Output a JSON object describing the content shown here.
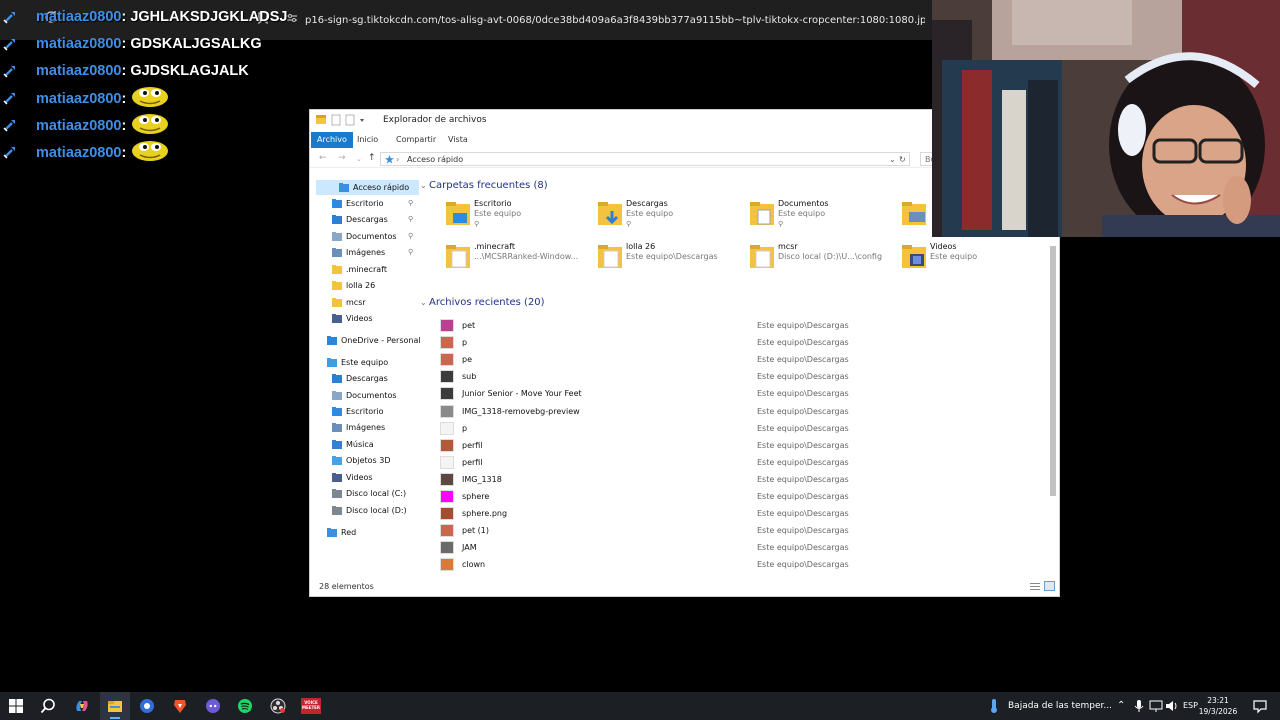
{
  "browser": {
    "url": "p16-sign-sg.tiktokcdn.com/tos-alisg-avt-0068/0dce38bd409a6a3f8439bb377a9115bb~tplv-tiktokx-cropcenter:1080:1080.jpeg?dr=14579&refresh_to..."
  },
  "chat": {
    "messages": [
      {
        "user": "matiaaz0800",
        "text": "JGHLAKSDJGKLADSJ",
        "emote": false
      },
      {
        "user": "matiaaz0800",
        "text": "GDSKALJGSALKG",
        "emote": false
      },
      {
        "user": "matiaaz0800",
        "text": "GJDSKLAGJALK",
        "emote": false
      },
      {
        "user": "matiaaz0800",
        "text": "",
        "emote": true
      },
      {
        "user": "matiaaz0800",
        "text": "",
        "emote": true
      },
      {
        "user": "matiaaz0800",
        "text": "",
        "emote": true
      }
    ],
    "colon": ":",
    "colors": {
      "username": "#3f8ee8",
      "text": "#ffffff"
    }
  },
  "explorer": {
    "title": "Explorador de archivos",
    "ribbon_tabs": [
      "Archivo",
      "Inicio",
      "Compartir",
      "Vista"
    ],
    "address_path": "Acceso rápido",
    "search_placeholder": "Bu",
    "nav_items": [
      {
        "label": "Acceso rápido",
        "icon": "star-icon",
        "pinned": false
      },
      {
        "label": "Escritorio",
        "icon": "desktop-folder-icon",
        "pinned": true
      },
      {
        "label": "Descargas",
        "icon": "download-folder-icon",
        "pinned": true
      },
      {
        "label": "Documentos",
        "icon": "documents-folder-icon",
        "pinned": true
      },
      {
        "label": "Imágenes",
        "icon": "pictures-folder-icon",
        "pinned": true
      },
      {
        "label": ".minecraft",
        "icon": "folder-icon",
        "pinned": false
      },
      {
        "label": "lolla 26",
        "icon": "folder-icon",
        "pinned": false
      },
      {
        "label": "mcsr",
        "icon": "folder-icon",
        "pinned": false
      },
      {
        "label": "Videos",
        "icon": "videos-folder-icon",
        "pinned": false
      },
      {
        "label": "OneDrive - Personal",
        "icon": "cloud-icon",
        "pinned": false
      },
      {
        "label": "Este equipo",
        "icon": "computer-icon",
        "pinned": false
      },
      {
        "label": "Descargas",
        "icon": "download-folder-icon",
        "pinned": false
      },
      {
        "label": "Documentos",
        "icon": "documents-folder-icon",
        "pinned": false
      },
      {
        "label": "Escritorio",
        "icon": "desktop-folder-icon",
        "pinned": false
      },
      {
        "label": "Imágenes",
        "icon": "pictures-folder-icon",
        "pinned": false
      },
      {
        "label": "Música",
        "icon": "music-icon",
        "pinned": false
      },
      {
        "label": "Objetos 3D",
        "icon": "cube-icon",
        "pinned": false
      },
      {
        "label": "Videos",
        "icon": "videos-folder-icon",
        "pinned": false
      },
      {
        "label": "Disco local (C:)",
        "icon": "drive-icon",
        "pinned": false
      },
      {
        "label": "Disco local (D:)",
        "icon": "drive-icon",
        "pinned": false
      },
      {
        "label": "Red",
        "icon": "network-icon",
        "pinned": false
      }
    ],
    "frequent_header": "Carpetas frecuentes (8)",
    "frequent_folders": [
      {
        "name": "Escritorio",
        "sub": "Este equipo",
        "pinned": true,
        "icon": "desktop-folder-icon"
      },
      {
        "name": "Descargas",
        "sub": "Este equipo",
        "pinned": true,
        "icon": "download-folder-icon"
      },
      {
        "name": "Documentos",
        "sub": "Este equipo",
        "pinned": true,
        "icon": "documents-folder-icon"
      },
      {
        "name": "",
        "sub": "",
        "pinned": false,
        "icon": "pictures-folder-icon"
      },
      {
        "name": ".minecraft",
        "sub": "...\\MCSRRanked-Window...",
        "pinned": false,
        "icon": "folder-icon"
      },
      {
        "name": "lolla 26",
        "sub": "Este equipo\\Descargas",
        "pinned": false,
        "icon": "folder-icon"
      },
      {
        "name": "mcsr",
        "sub": "Disco local (D:)\\U...\\config",
        "pinned": false,
        "icon": "folder-icon"
      },
      {
        "name": "Videos",
        "sub": "Este equipo",
        "pinned": false,
        "icon": "videos-folder-icon"
      }
    ],
    "recent_header": "Archivos recientes (20)",
    "recent_files": [
      {
        "name": "pet",
        "location": "Este equipo\\Descargas",
        "thumb": "#b8428f"
      },
      {
        "name": "p",
        "location": "Este equipo\\Descargas",
        "thumb": "#c9684f"
      },
      {
        "name": "pe",
        "location": "Este equipo\\Descargas",
        "thumb": "#c9684f"
      },
      {
        "name": "sub",
        "location": "Este equipo\\Descargas",
        "thumb": "#3b3b3b"
      },
      {
        "name": "Junior Senior - Move Your Feet",
        "location": "Este equipo\\Descargas",
        "thumb": "#3b3b3b"
      },
      {
        "name": "IMG_1318-removebg-preview",
        "location": "Este equipo\\Descargas",
        "thumb": "#8a8a8a"
      },
      {
        "name": "p",
        "location": "Este equipo\\Descargas",
        "thumb": "#f4f4f4"
      },
      {
        "name": "perfil",
        "location": "Este equipo\\Descargas",
        "thumb": "#b05a3c"
      },
      {
        "name": "perfil",
        "location": "Este equipo\\Descargas",
        "thumb": "#f4f4f4"
      },
      {
        "name": "IMG_1318",
        "location": "Este equipo\\Descargas",
        "thumb": "#5c4a40"
      },
      {
        "name": "sphere",
        "location": "Este equipo\\Descargas",
        "thumb": "#ff00ff"
      },
      {
        "name": "sphere.png",
        "location": "Este equipo\\Descargas",
        "thumb": "#a05030"
      },
      {
        "name": "pet (1)",
        "location": "Este equipo\\Descargas",
        "thumb": "#c9684f"
      },
      {
        "name": "JAM",
        "location": "Este equipo\\Descargas",
        "thumb": "#6a6a6a"
      },
      {
        "name": "clown",
        "location": "Este equipo\\Descargas",
        "thumb": "#d87a3a"
      }
    ],
    "status_count": "28 elementos"
  },
  "taskbar": {
    "weather": "Bajada de las temper...",
    "language": "ESP",
    "time": "23:21",
    "date": "19/3/2026",
    "badge_text": "VOICE\nMEETER"
  }
}
